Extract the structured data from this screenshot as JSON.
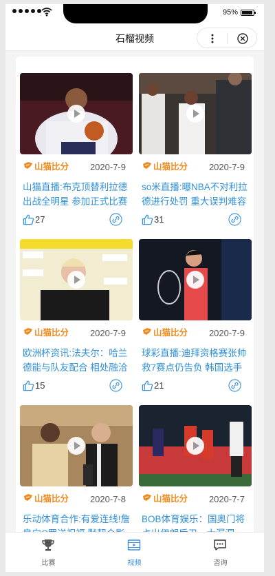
{
  "status_bar": {
    "battery": "95%"
  },
  "nav": {
    "title": "石榴视频"
  },
  "brand": {
    "logo_text": "山猫比分"
  },
  "cards": [
    {
      "date": "2020-7-9",
      "title": "山猫直播:布克顶替利拉德出战全明星 参加正式比赛",
      "likes": "27"
    },
    {
      "date": "2020-7-9",
      "title": "so米直播:曝NBA不对利拉德进行处罚 重大误判难容忍",
      "likes": "31"
    },
    {
      "date": "2020-7-9",
      "title": "欧洲杯资讯:法夫尔：哈兰德能与队友配合 相处融洽",
      "likes": "15"
    },
    {
      "date": "2020-7-9",
      "title": "球彩直播:迪拜资格赛张帅救7赛点仍告负 韩国选手",
      "likes": "21"
    },
    {
      "date": "2020-7-8",
      "title": "乐动体育合作:有爱连线!詹皇向C罗送祝福 默契合影",
      "likes": ""
    },
    {
      "date": "2020-7-7",
      "title": "BOB体育娱乐：国奥门将点出伊朗后卫一大漏洞",
      "likes": ""
    }
  ],
  "tabs": [
    {
      "label": "比赛",
      "icon": "trophy-icon"
    },
    {
      "label": "视频",
      "icon": "video-icon",
      "active": true
    },
    {
      "label": "咨询",
      "icon": "message-icon"
    }
  ],
  "colors": {
    "accent": "#3a8ee6",
    "title_blue": "#2f8fd6",
    "logo_orange": "#f08a1d"
  }
}
